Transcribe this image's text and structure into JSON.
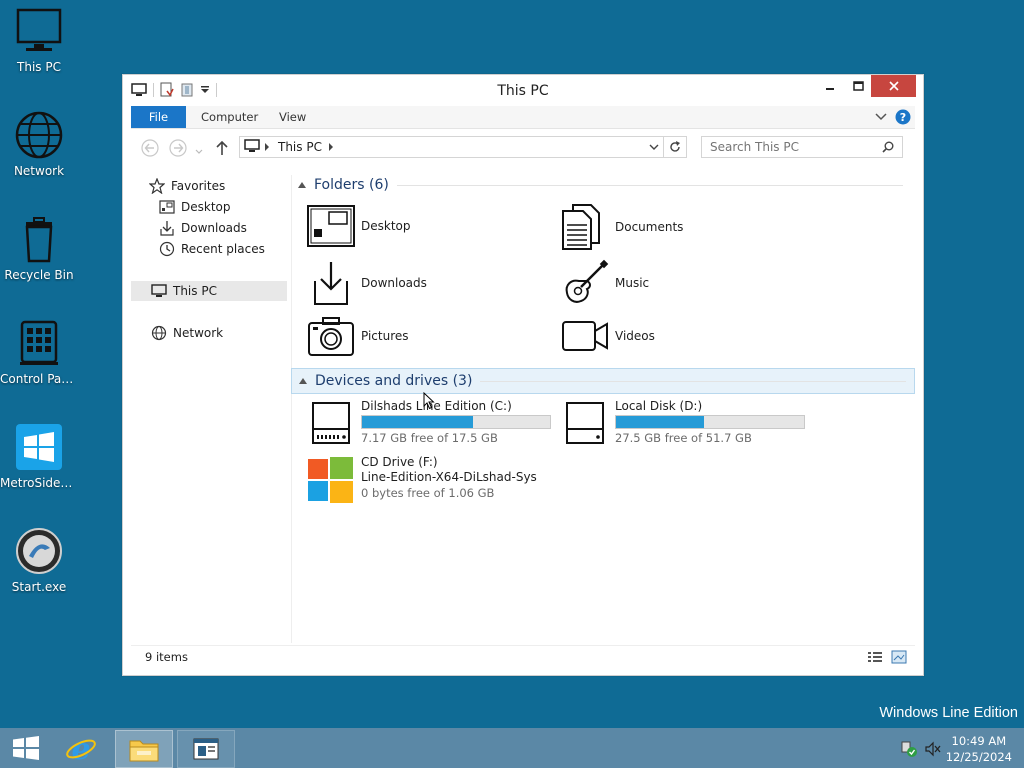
{
  "desktop": {
    "icons": [
      {
        "label": "This PC"
      },
      {
        "label": "Network"
      },
      {
        "label": "Recycle Bin"
      },
      {
        "label": "Control Panel"
      },
      {
        "label": "MetroSideb..."
      },
      {
        "label": "Start.exe"
      }
    ],
    "watermark": "Windows Line Edition"
  },
  "window": {
    "title": "This PC",
    "ribbon": {
      "tabs": [
        "File",
        "Computer",
        "View"
      ]
    },
    "address": {
      "crumb": "This PC"
    },
    "search": {
      "placeholder": "Search This PC"
    },
    "navpane": {
      "favorites": "Favorites",
      "favorites_items": [
        "Desktop",
        "Downloads",
        "Recent places"
      ],
      "this_pc": "This PC",
      "network": "Network"
    },
    "folders": {
      "header": "Folders (6)",
      "items": [
        "Desktop",
        "Documents",
        "Downloads",
        "Music",
        "Pictures",
        "Videos"
      ]
    },
    "devices": {
      "header": "Devices and drives (3)",
      "drives": [
        {
          "name": "Dilshads Line Edition (C:)",
          "free": "7.17 GB free of 17.5 GB",
          "used_fraction": 0.59
        },
        {
          "name": "Local Disk (D:)",
          "free": "27.5 GB free of 51.7 GB",
          "used_fraction": 0.47
        }
      ],
      "cd": {
        "name": "CD Drive (F:)",
        "label": "Line-Edition-X64-DiLshad-Sys",
        "free": "0 bytes free of 1.06 GB"
      }
    },
    "status": {
      "items": "9 items"
    }
  },
  "taskbar": {
    "clock": {
      "time": "10:49 AM",
      "date": "12/25/2024"
    }
  },
  "colors": {
    "desktop": "#0f6b95",
    "accent": "#1b76c8",
    "drive_bar": "#269bd7",
    "close": "#c7463f"
  }
}
